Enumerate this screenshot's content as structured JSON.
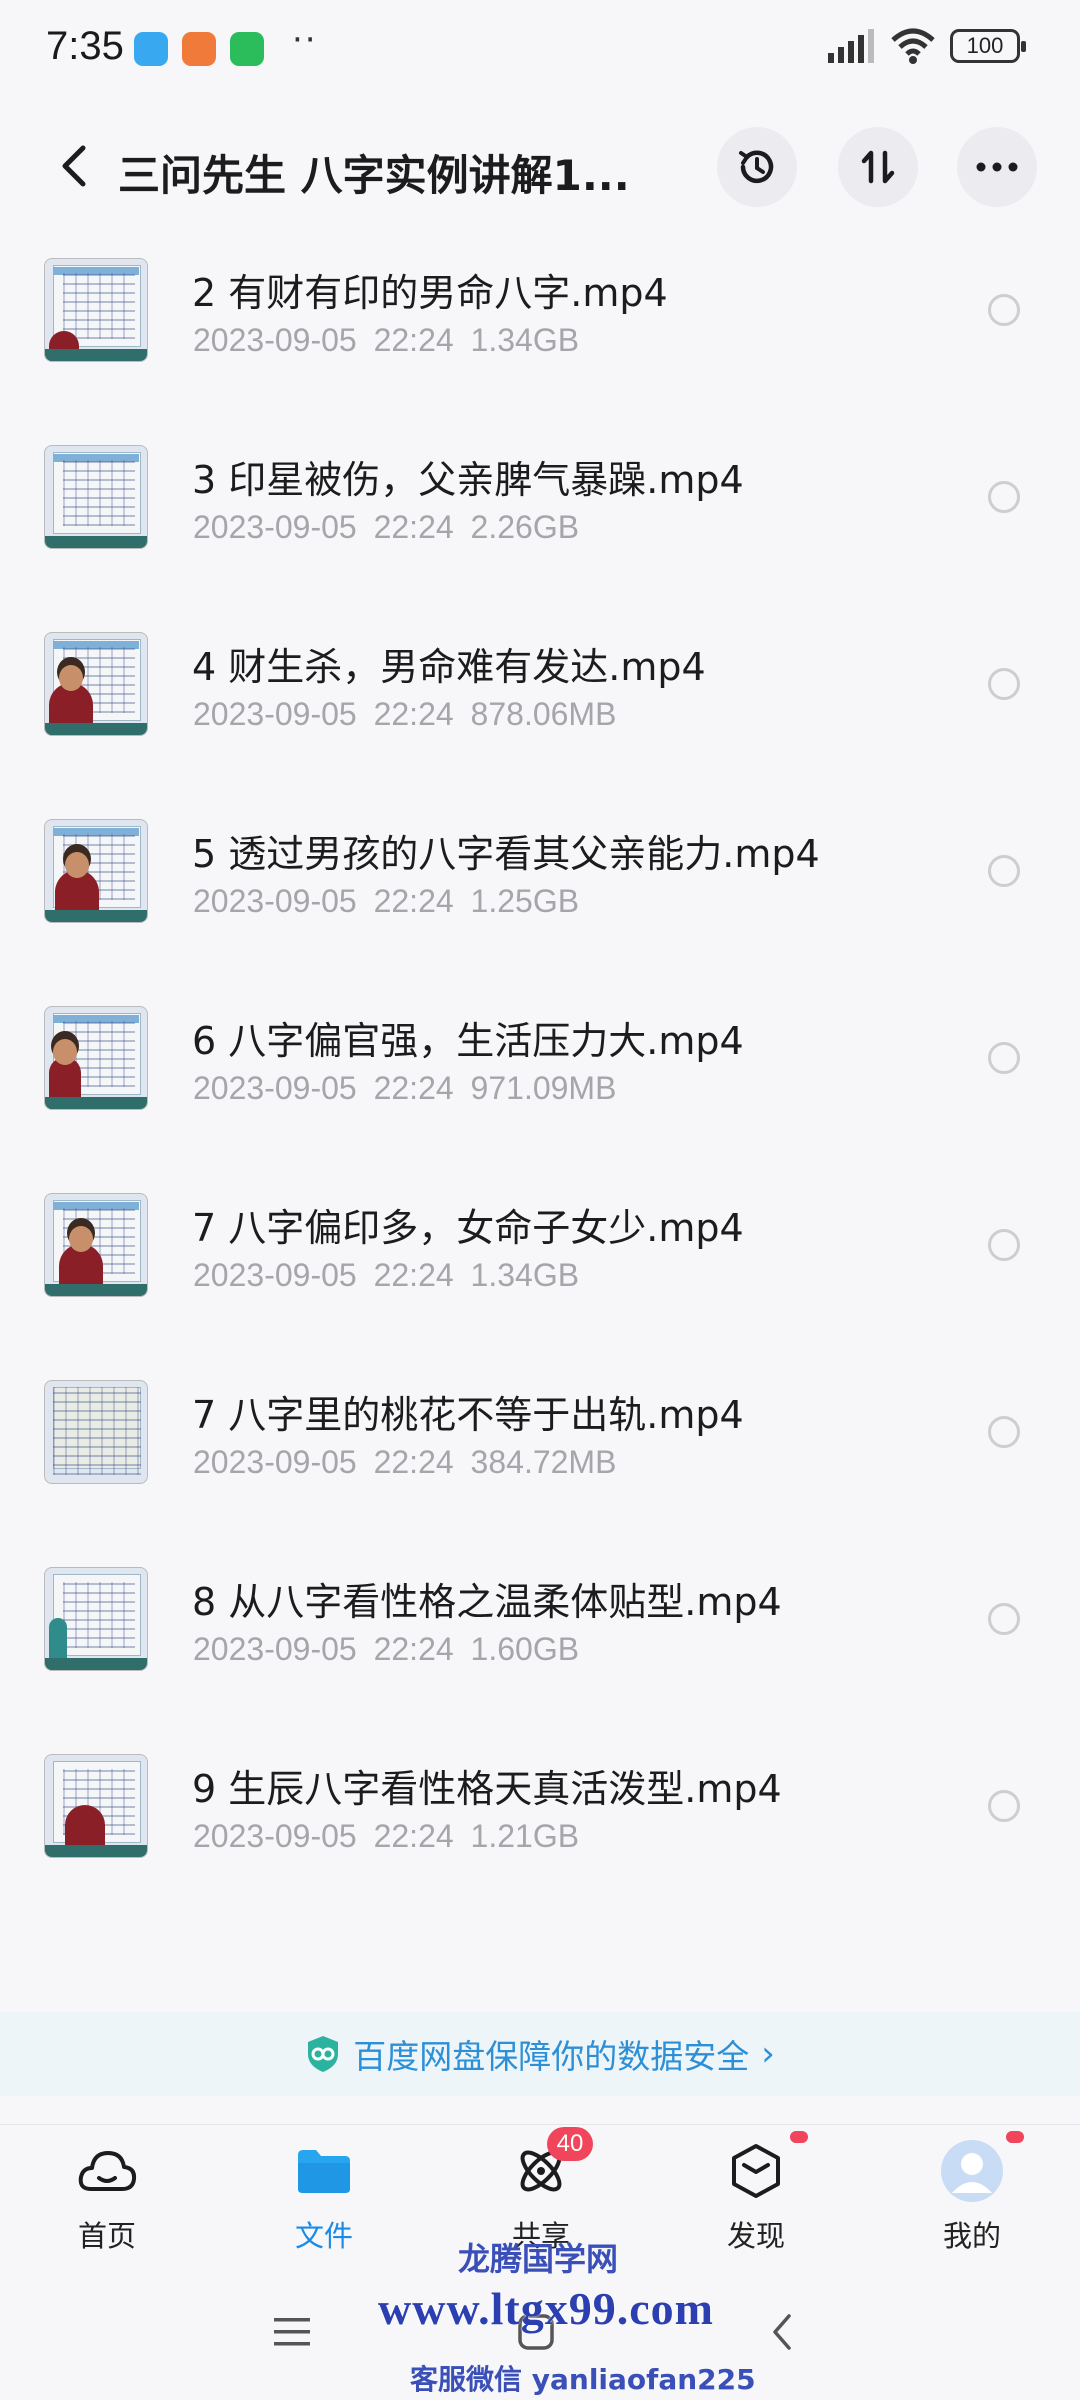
{
  "status_bar": {
    "time": "7:35",
    "dots": "··",
    "battery": "100",
    "apps": [
      "messages-icon",
      "store-icon",
      "phone-icon"
    ]
  },
  "header": {
    "title": "三问先生 八字实例讲解1..."
  },
  "files": [
    {
      "name": "2 有财有印的男命八字.mp4",
      "meta": "2023-09-05  22:24  1.34GB"
    },
    {
      "name": "3 印星被伤，父亲脾气暴躁.mp4",
      "meta": "2023-09-05  22:24  2.26GB"
    },
    {
      "name": "4 财生杀，男命难有发达.mp4",
      "meta": "2023-09-05  22:24  878.06MB"
    },
    {
      "name": "5 透过男孩的八字看其父亲能力.mp4",
      "meta": "2023-09-05  22:24  1.25GB"
    },
    {
      "name": "6 八字偏官强，生活压力大.mp4",
      "meta": "2023-09-05  22:24  971.09MB"
    },
    {
      "name": "7 八字偏印多，女命子女少.mp4",
      "meta": "2023-09-05  22:24  1.34GB"
    },
    {
      "name": "7 八字里的桃花不等于出轨.mp4",
      "meta": "2023-09-05  22:24  384.72MB"
    },
    {
      "name": "8 从八字看性格之温柔体贴型.mp4",
      "meta": "2023-09-05  22:24  1.60GB"
    },
    {
      "name": "9 生辰八字看性格天真活泼型.mp4",
      "meta": "2023-09-05  22:24  1.21GB"
    }
  ],
  "security": {
    "text": "百度网盘保障你的数据安全",
    "arrow": "›"
  },
  "nav": {
    "home": "首页",
    "files": "文件",
    "share": "共享",
    "share_badge": "40",
    "discover": "发现",
    "me": "我的"
  },
  "watermark": {
    "line1": "龙腾国学网",
    "line2": "www.ltgx99.com",
    "line3": "客服微信 yanliaofan225"
  },
  "colors": {
    "accent": "#1a8be8",
    "badge": "#f0455a",
    "meta_text": "#a5a5ab"
  }
}
